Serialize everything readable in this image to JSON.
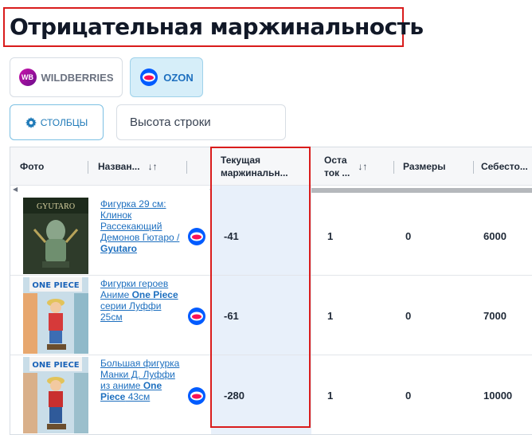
{
  "page_title": "Отрицательная маржинальность",
  "marketplaces": [
    {
      "label": "WILDBERRIES",
      "logo_text": "WB",
      "active": false
    },
    {
      "label": "OZON",
      "active": true
    }
  ],
  "toolbar": {
    "columns_label": "СТОЛБЦЫ",
    "row_height_label": "Высота строки"
  },
  "table": {
    "headers": {
      "photo": "Фото",
      "name": "Назван...",
      "margin_line1": "Текущая",
      "margin_line2": "маржинальн...",
      "stock_line1": "Оста",
      "stock_line2": "ток ...",
      "sizes": "Размеры",
      "cost": "Себесто..."
    },
    "sort_icon": "↓↑",
    "rows": [
      {
        "name_parts": [
          "Фигурка 29 см: Клинок Рассекающий Демонов Гютаро / ",
          "Gyutaro"
        ],
        "margin": "-41",
        "stock": "1",
        "sizes": "0",
        "cost": "6000"
      },
      {
        "name_parts": [
          "Фигурки героев Аниме ",
          "One Piece",
          " серии Луффи 25см"
        ],
        "margin": "-61",
        "stock": "1",
        "sizes": "0",
        "cost": "7000"
      },
      {
        "name_parts": [
          "Большая фигурка Манки Д. Луффи из аниме ",
          "One Piece",
          " 43см"
        ],
        "margin": "-280",
        "stock": "1",
        "sizes": "0",
        "cost": "10000"
      }
    ]
  },
  "colors": {
    "accent": "#1d6fbf",
    "highlight_border": "#d91c1c",
    "ozon_blue": "#005bff",
    "ozon_red": "#f91155"
  }
}
